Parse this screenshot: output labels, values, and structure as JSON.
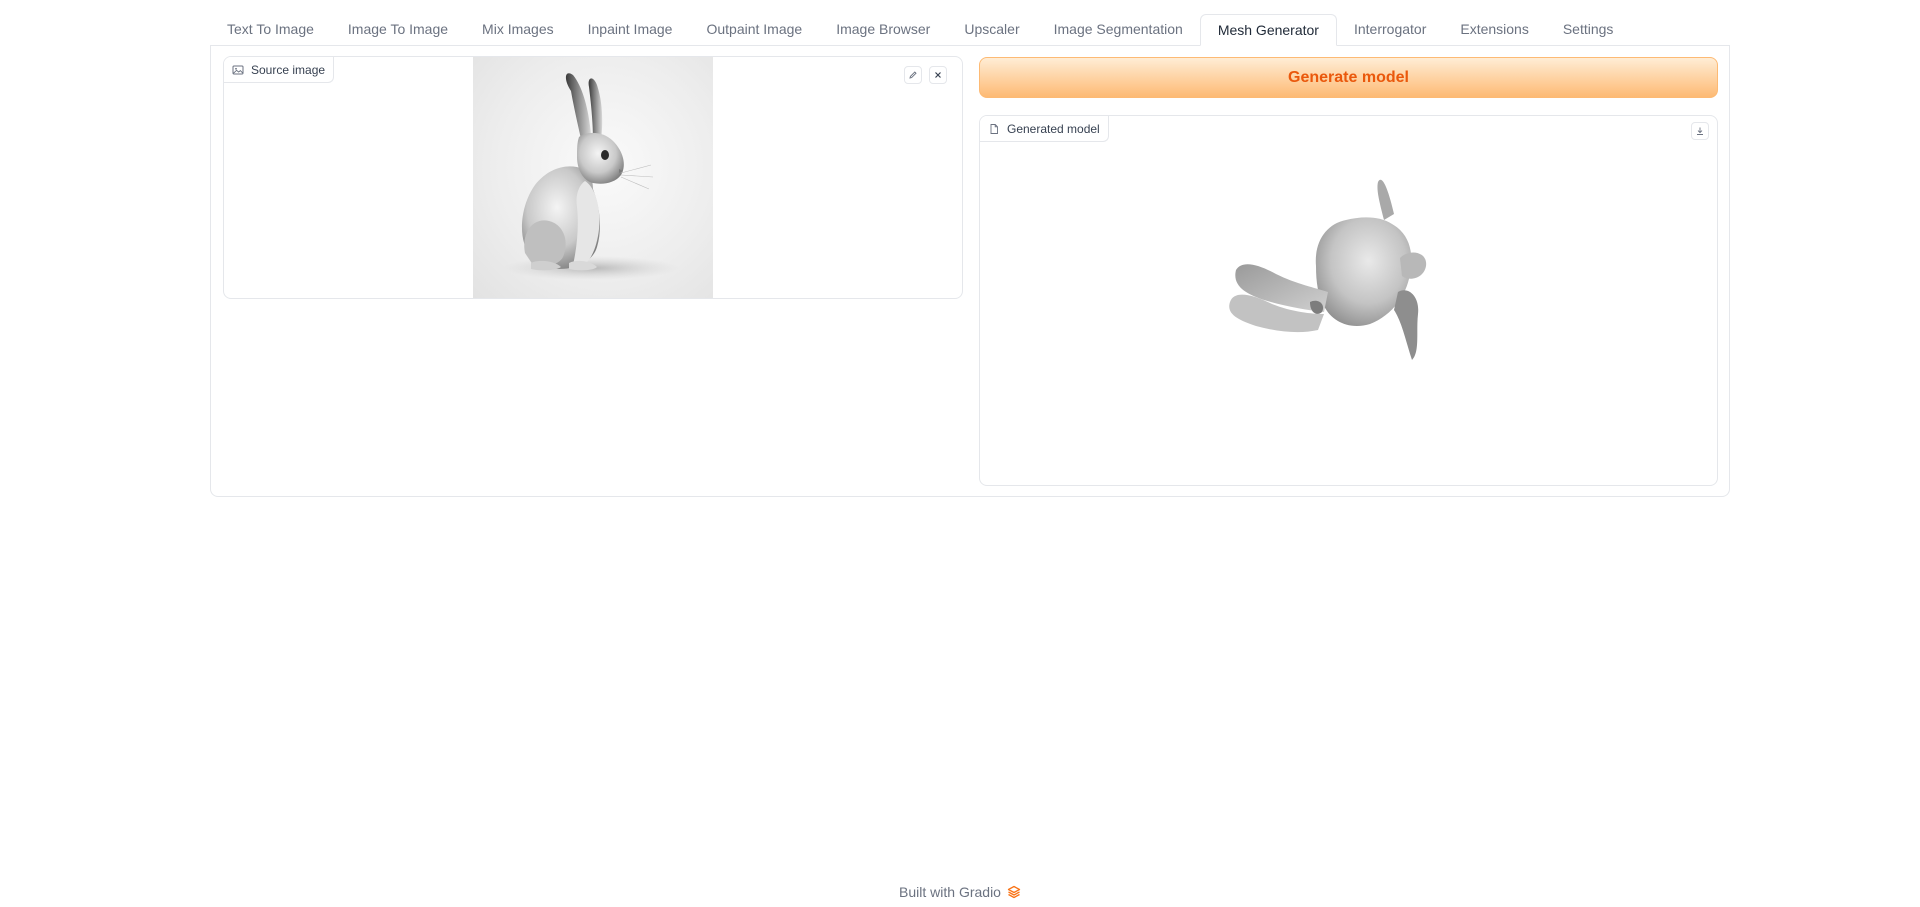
{
  "tabs": [
    {
      "label": "Text To Image",
      "selected": false
    },
    {
      "label": "Image To Image",
      "selected": false
    },
    {
      "label": "Mix Images",
      "selected": false
    },
    {
      "label": "Inpaint Image",
      "selected": false
    },
    {
      "label": "Outpaint Image",
      "selected": false
    },
    {
      "label": "Image Browser",
      "selected": false
    },
    {
      "label": "Upscaler",
      "selected": false
    },
    {
      "label": "Image Segmentation",
      "selected": false
    },
    {
      "label": "Mesh Generator",
      "selected": true
    },
    {
      "label": "Interrogator",
      "selected": false
    },
    {
      "label": "Extensions",
      "selected": false
    },
    {
      "label": "Settings",
      "selected": false
    }
  ],
  "source": {
    "label": "Source image",
    "label_icon": "image-icon",
    "actions": {
      "edit_icon": "pencil-icon",
      "clear_icon": "close-icon"
    }
  },
  "generate": {
    "label": "Generate model"
  },
  "model": {
    "label": "Generated model",
    "label_icon": "file-icon",
    "download_icon": "download-icon"
  },
  "footer": {
    "text": "Built with Gradio",
    "logo_icon": "gradio-logo-icon"
  },
  "colors": {
    "accent": "#ea580c",
    "button_gradient_top": "#ffedd5",
    "button_gradient_bottom": "#fdba74",
    "border": "#e5e7eb",
    "muted_text": "#6b7280"
  }
}
